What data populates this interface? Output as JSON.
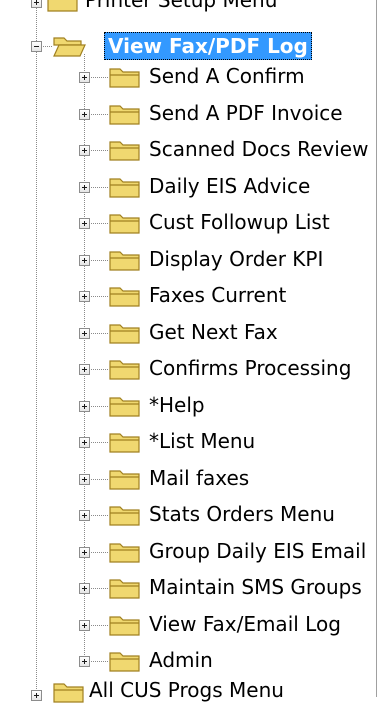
{
  "tree": {
    "top_partial_item": {
      "label": "Printer Setup Menu"
    },
    "selected_node": {
      "label": "View Fax/PDF Log"
    },
    "children": [
      {
        "label": "Send A Confirm"
      },
      {
        "label": "Send A PDF Invoice"
      },
      {
        "label": "Scanned Docs Review"
      },
      {
        "label": "Daily EIS Advice"
      },
      {
        "label": "Cust Followup List"
      },
      {
        "label": "Display Order KPI"
      },
      {
        "label": "Faxes Current"
      },
      {
        "label": "Get Next Fax"
      },
      {
        "label": "Confirms Processing"
      },
      {
        "label": "*Help"
      },
      {
        "label": "*List Menu"
      },
      {
        "label": "Mail faxes"
      },
      {
        "label": "Stats Orders Menu"
      },
      {
        "label": "Group Daily EIS Email"
      },
      {
        "label": "Maintain SMS Groups"
      },
      {
        "label": "View Fax/Email Log"
      },
      {
        "label": "Admin"
      }
    ],
    "bottom_partial_item": {
      "label": "All CUS Progs Menu"
    }
  },
  "colors": {
    "selection_bg": "#3399ff",
    "folder_fill": "#f0d870",
    "folder_edge": "#a08020"
  },
  "icons": {
    "expander_collapsed": "plus-box-icon",
    "expander_expanded": "minus-box-icon",
    "folder_closed": "folder-icon",
    "folder_open": "open-folder-icon"
  }
}
